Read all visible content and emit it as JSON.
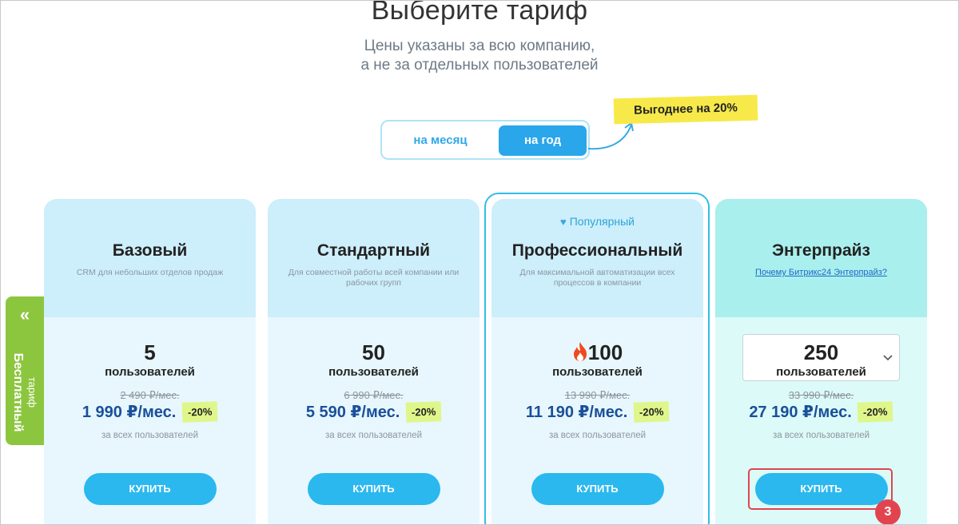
{
  "header": {
    "title": "Выберите тариф",
    "subtitle_line1": "Цены указаны за всю компанию,",
    "subtitle_line2": "а не за отдельных пользователей"
  },
  "billing_toggle": {
    "month_label": "на месяц",
    "year_label": "на год",
    "selected": "year",
    "promo": "Выгоднее на 20%"
  },
  "free_tab": {
    "arrow": "«",
    "small": "тариф",
    "big": "Бесплатный"
  },
  "plans": [
    {
      "name": "Базовый",
      "description": "CRM для небольших отделов продаж",
      "users": "5",
      "users_label": "пользователей",
      "old_price": "2 490 ₽/мес.",
      "price": "1 990 ₽/мес.",
      "discount": "-20%",
      "per_all": "за всех пользователей",
      "buy_label": "КУПИТЬ"
    },
    {
      "name": "Стандартный",
      "description": "Для совместной работы всей компании или рабочих групп",
      "users": "50",
      "users_label": "пользователей",
      "old_price": "6 990 ₽/мес.",
      "price": "5 590 ₽/мес.",
      "discount": "-20%",
      "per_all": "за всех пользователей",
      "buy_label": "КУПИТЬ"
    },
    {
      "name": "Профессиональный",
      "badge": "Популярный",
      "description": "Для максимальной автоматизации всех процессов в компании",
      "users": "100",
      "users_label": "пользователей",
      "old_price": "13 990 ₽/мес.",
      "price": "11 190 ₽/мес.",
      "discount": "-20%",
      "per_all": "за всех пользователей",
      "buy_label": "КУПИТЬ"
    },
    {
      "name": "Энтерпрайз",
      "link": "Почему Битрикс24 Энтерпрайз?",
      "users": "250",
      "users_label": "пользователей",
      "old_price": "33 990 ₽/мес.",
      "price": "27 190 ₽/мес.",
      "discount": "-20%",
      "per_all": "за всех пользователей",
      "buy_label": "КУПИТЬ"
    }
  ],
  "annotation": {
    "step": "3"
  },
  "icons": {
    "heart": "heart-icon",
    "fire": "fire-icon",
    "chevron": "chevron-down-icon",
    "arrow": "curved-arrow-icon"
  },
  "colors": {
    "accent": "#2ab8ef",
    "price": "#1a4f9a",
    "discount_bg": "#dff68a",
    "promo_bg": "#f7e94a",
    "free_tab": "#8cc63f",
    "highlight": "#e2444f"
  }
}
